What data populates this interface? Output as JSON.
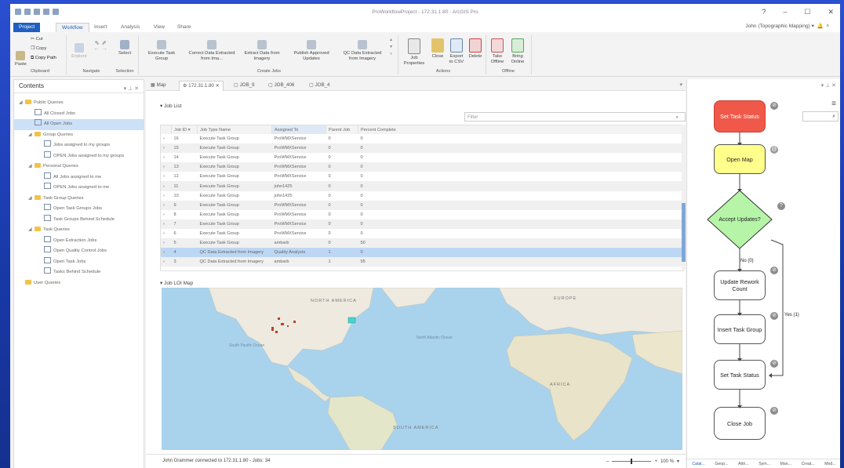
{
  "window": {
    "title": "ProWorkflowProject - 172.31.1.80 - ArcGIS Pro",
    "user": "John (Topographic Mapping)",
    "help": "?",
    "minimize": "–",
    "maximize": "☐",
    "close": "✕"
  },
  "ribbon_tabs": [
    "Project",
    "Workflow",
    "Insert",
    "Analysis",
    "View",
    "Share"
  ],
  "ribbon": {
    "clipboard": {
      "paste": "Paste",
      "cut": "Cut",
      "copy": "Copy",
      "copy_path": "Copy Path",
      "group": "Clipboard"
    },
    "navigate": {
      "explore": "Explore",
      "group": "Navigate"
    },
    "selection": {
      "select": "Select",
      "group": "Selection"
    },
    "create_jobs": {
      "items": [
        "Execute Task Group",
        "Correct Data Extracted from Ima...",
        "Extract Data from Imagery",
        "Publish Approved Updates",
        "QC Data Extracted from Imagery"
      ],
      "group": "Create Jobs"
    },
    "actions": {
      "items": [
        "Job Properties",
        "Close",
        "Export to CSV",
        "Delete"
      ],
      "group": "Actions"
    },
    "offline": {
      "items": [
        "Take Offline",
        "Bring Online"
      ],
      "group": "Offline"
    }
  },
  "contents": {
    "title": "Contents",
    "tree": [
      {
        "label": "Public Queries",
        "level": 0,
        "type": "folder",
        "arrow": "◢"
      },
      {
        "label": "All Closed Jobs",
        "level": 1,
        "type": "query"
      },
      {
        "label": "All Open Jobs",
        "level": 1,
        "type": "query",
        "selected": true
      },
      {
        "label": "Group Queries",
        "level": 1,
        "type": "folder",
        "arrow": "◢"
      },
      {
        "label": "Jobs assigned to my groups",
        "level": 2,
        "type": "query"
      },
      {
        "label": "OPEN Jobs assigned to my groups",
        "level": 2,
        "type": "query"
      },
      {
        "label": "Personal Queries",
        "level": 1,
        "type": "folder",
        "arrow": "◢"
      },
      {
        "label": "All Jobs assigned to me",
        "level": 2,
        "type": "query"
      },
      {
        "label": "OPEN Jobs assigned to me",
        "level": 2,
        "type": "query"
      },
      {
        "label": "Task Group Queries",
        "level": 1,
        "type": "folder",
        "arrow": "◢"
      },
      {
        "label": "Open Task Groups Jobs",
        "level": 2,
        "type": "query"
      },
      {
        "label": "Task Groups Behind Schedule",
        "level": 2,
        "type": "query"
      },
      {
        "label": "Task Queries",
        "level": 1,
        "type": "folder",
        "arrow": "◢"
      },
      {
        "label": "Open Extraction Jobs",
        "level": 2,
        "type": "query"
      },
      {
        "label": "Open Quality Control Jobs",
        "level": 2,
        "type": "query"
      },
      {
        "label": "Open Task Jobs",
        "level": 2,
        "type": "query"
      },
      {
        "label": "Tasks Behind Schedule",
        "level": 2,
        "type": "query"
      },
      {
        "label": "User Queries",
        "level": 0,
        "type": "folder",
        "arrow": ""
      }
    ]
  },
  "doc_tabs": [
    "Map",
    "172.31.1.80",
    "JOB_9",
    "JOB_406",
    "JOB_4"
  ],
  "job_list": {
    "title": "Job List",
    "filter_placeholder": "Filter",
    "columns": [
      "Job ID",
      "Job Type Name",
      "Assigned To",
      "Parent Job",
      "Percent Complete"
    ],
    "rows": [
      {
        "id": "16",
        "type": "Execute Task Group",
        "assigned": "ProWMXService",
        "parent": "0",
        "pct": "0"
      },
      {
        "id": "15",
        "type": "Execute Task Group",
        "assigned": "ProWMXService",
        "parent": "0",
        "pct": "0"
      },
      {
        "id": "14",
        "type": "Execute Task Group",
        "assigned": "ProWMXService",
        "parent": "0",
        "pct": "0"
      },
      {
        "id": "13",
        "type": "Execute Task Group",
        "assigned": "ProWMXService",
        "parent": "0",
        "pct": "0"
      },
      {
        "id": "12",
        "type": "Execute Task Group",
        "assigned": "ProWMXService",
        "parent": "0",
        "pct": "0"
      },
      {
        "id": "11",
        "type": "Execute Task Group",
        "assigned": "john1425",
        "parent": "0",
        "pct": "0"
      },
      {
        "id": "10",
        "type": "Execute Task Group",
        "assigned": "john1425",
        "parent": "0",
        "pct": "0"
      },
      {
        "id": "9",
        "type": "Execute Task Group",
        "assigned": "ProWMXService",
        "parent": "0",
        "pct": "0"
      },
      {
        "id": "8",
        "type": "Execute Task Group",
        "assigned": "ProWMXService",
        "parent": "0",
        "pct": "0"
      },
      {
        "id": "7",
        "type": "Execute Task Group",
        "assigned": "ProWMXService",
        "parent": "0",
        "pct": "0"
      },
      {
        "id": "6",
        "type": "Execute Task Group",
        "assigned": "ProWMXService",
        "parent": "0",
        "pct": "0"
      },
      {
        "id": "5",
        "type": "Execute Task Group",
        "assigned": "ambarb",
        "parent": "0",
        "pct": "50"
      },
      {
        "id": "4",
        "type": "QC Data Extracted from Imagery",
        "assigned": "Quality Analysts",
        "parent": "1",
        "pct": "0",
        "selected": true
      },
      {
        "id": "3",
        "type": "QC Data Extracted from Imagery",
        "assigned": "ambarb",
        "parent": "1",
        "pct": "95"
      }
    ]
  },
  "map": {
    "title": "Job LOI Map",
    "labels": {
      "north_america": "NORTH AMERICA",
      "europe": "EUROPE",
      "south_pacific": "South Pacific Ocean",
      "north_atlantic": "North Atlantic Ocean",
      "africa": "AFRICA",
      "south_america": "SOUTH AMERICA"
    }
  },
  "status": {
    "text": "John Grammer connected to 172.31.1.80 - Jobs: 34",
    "zoom": "100 %"
  },
  "workflow": {
    "steps": [
      "Set Task Status",
      "Open Map",
      "Accept Updates?",
      "Update Rework Count",
      "Insert Task Group",
      "Set Task Status",
      "Close Job"
    ],
    "edge_no": "No (0)",
    "edge_yes": "Yes (1)",
    "colors": {
      "active": "#f0594a",
      "current": "#ffff8c"
    },
    "bottom_tabs": [
      "Catal...",
      "Geop...",
      "Attri...",
      "Sym...",
      "Man...",
      "Creat...",
      "Mod..."
    ]
  }
}
